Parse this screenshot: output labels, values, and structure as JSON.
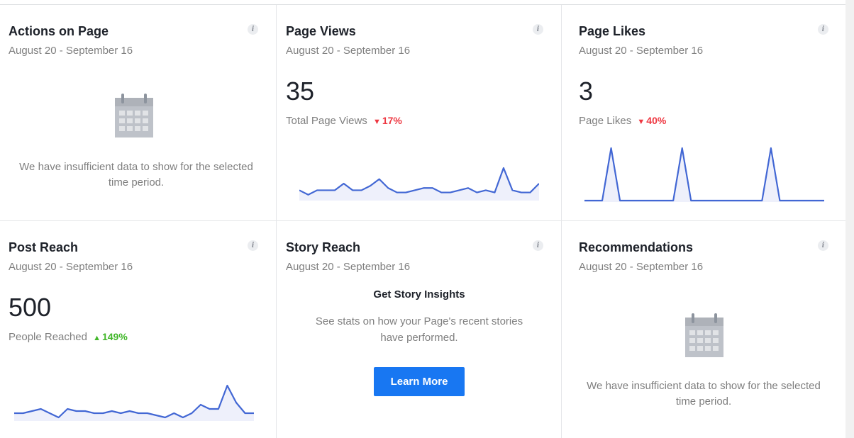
{
  "cards": {
    "actions": {
      "title": "Actions on Page",
      "date_range": "August 20 - September 16",
      "icon": "calendar-icon",
      "empty_message": "We have insufficient data to show for the selected time period."
    },
    "page_views": {
      "title": "Page Views",
      "date_range": "August 20 - September 16",
      "value": "35",
      "metric_label": "Total Page Views",
      "delta": "17%",
      "delta_direction": "down"
    },
    "page_likes": {
      "title": "Page Likes",
      "date_range": "August 20 - September 16",
      "value": "3",
      "metric_label": "Page Likes",
      "delta": "40%",
      "delta_direction": "down"
    },
    "post_reach": {
      "title": "Post Reach",
      "date_range": "August 20 - September 16",
      "value": "500",
      "metric_label": "People Reached",
      "delta": "149%",
      "delta_direction": "up"
    },
    "story_reach": {
      "title": "Story Reach",
      "date_range": "August 20 - September 16",
      "heading": "Get Story Insights",
      "description": "See stats on how your Page's recent stories have performed.",
      "button_label": "Learn More"
    },
    "recommendations": {
      "title": "Recommendations",
      "date_range": "August 20 - September 16",
      "icon": "calendar-icon",
      "empty_message": "We have insufficient data to show for the selected time period."
    }
  },
  "colors": {
    "accent": "#1877f2",
    "spark_line": "#4267d4",
    "spark_fill": "#eef0fb",
    "delta_down": "#ee3842",
    "delta_up": "#42b72a"
  },
  "sparklines": {
    "page_views": [
      4,
      2,
      4,
      4,
      4,
      7,
      4,
      4,
      6,
      9,
      5,
      3,
      3,
      4,
      5,
      5,
      3,
      3,
      4,
      5,
      3,
      4,
      3,
      14,
      4,
      3,
      3,
      7
    ],
    "page_likes": [
      0,
      0,
      0,
      1,
      0,
      0,
      0,
      0,
      0,
      0,
      0,
      1,
      0,
      0,
      0,
      0,
      0,
      0,
      0,
      0,
      0,
      1,
      0,
      0,
      0,
      0,
      0,
      0
    ],
    "post_reach": [
      3,
      3,
      4,
      5,
      3,
      1,
      5,
      4,
      4,
      3,
      3,
      4,
      3,
      4,
      3,
      3,
      2,
      1,
      3,
      1,
      3,
      7,
      5,
      5,
      16,
      8,
      3,
      3
    ]
  }
}
